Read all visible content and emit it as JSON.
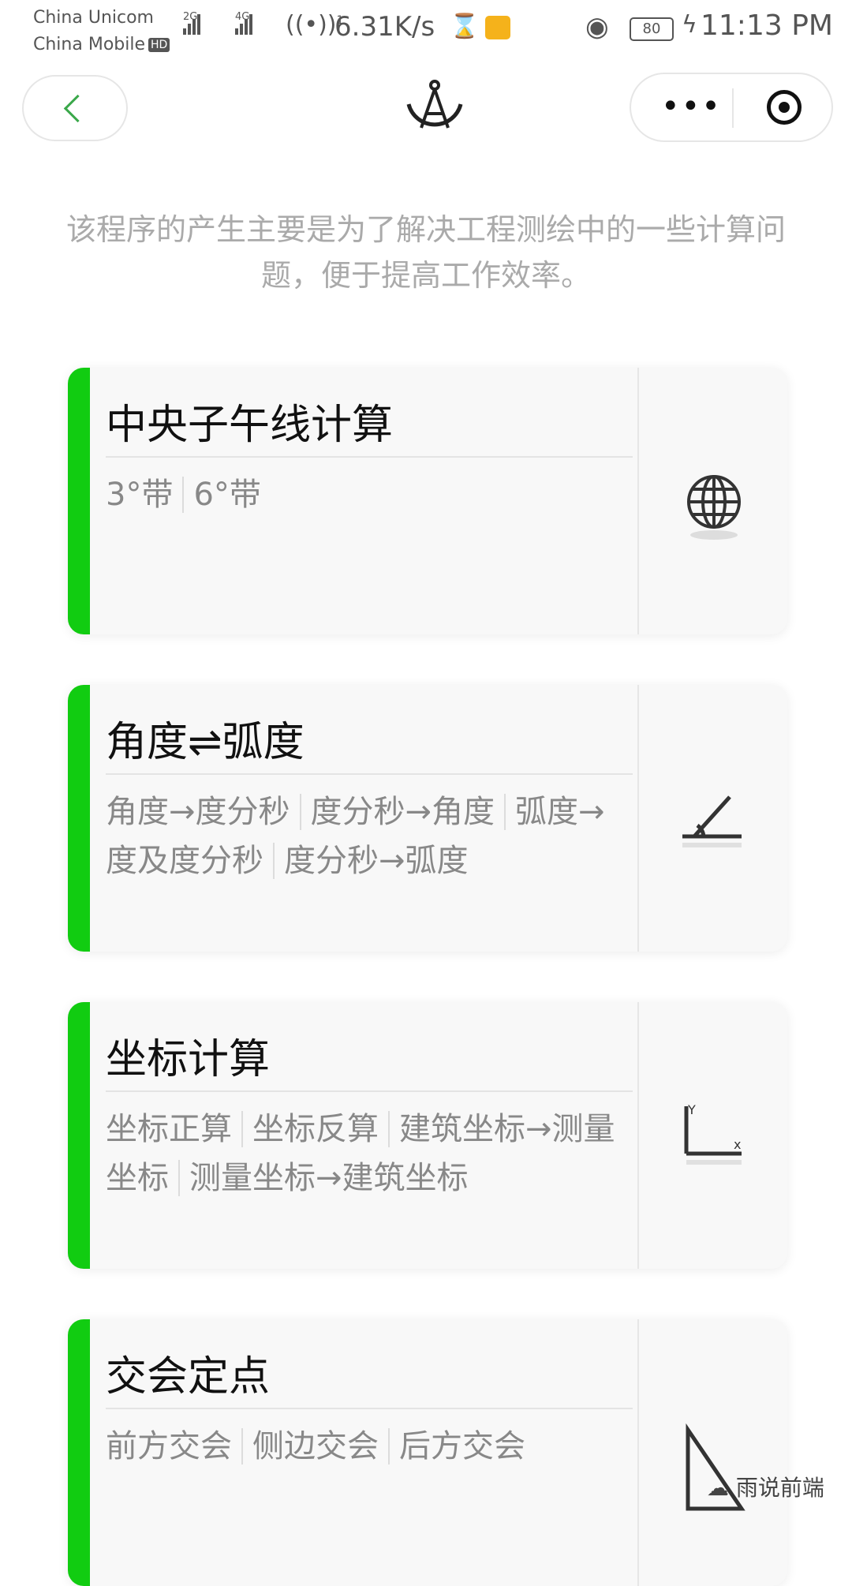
{
  "status_bar": {
    "carrier_1": "China Unicom",
    "carrier_2": "China Mobile",
    "hd_badge": "HD",
    "signal_1_label": "2G",
    "signal_2_label": "4G",
    "hotspot_count": "1",
    "net_speed": "6.31K/s",
    "battery": "80",
    "time": "11:13 PM"
  },
  "nav": {
    "back_icon": "chevron-left-icon",
    "logo_icon": "compass-logo-icon",
    "menu_icon": "more-dots-icon",
    "close_icon": "target-close-icon"
  },
  "intro_text": "该程序的产生主要是为了解决工程测绘中的一些计算问题，便于提高工作效率。",
  "cards": [
    {
      "title": "中央子午线计算",
      "links": [
        "3°带",
        "6°带"
      ],
      "icon": "globe-icon"
    },
    {
      "title": "角度⇌弧度",
      "links": [
        "角度→度分秒",
        "度分秒→角度",
        "弧度→度及度分秒",
        "度分秒→弧度"
      ],
      "icon": "angle-icon"
    },
    {
      "title": "坐标计算",
      "links": [
        "坐标正算",
        "坐标反算",
        "建筑坐标→测量坐标",
        "测量坐标→建筑坐标"
      ],
      "icon": "coordinate-axes-icon"
    },
    {
      "title": "交会定点",
      "links": [
        "前方交会",
        "侧边交会",
        "后方交会"
      ],
      "icon": "triangle-icon"
    }
  ],
  "watermark": "雨说前端",
  "colors": {
    "accent_green": "#11cc11",
    "back_chevron": "#3aa84a",
    "intro_gray": "#aaaaaa",
    "link_gray": "#888888"
  }
}
